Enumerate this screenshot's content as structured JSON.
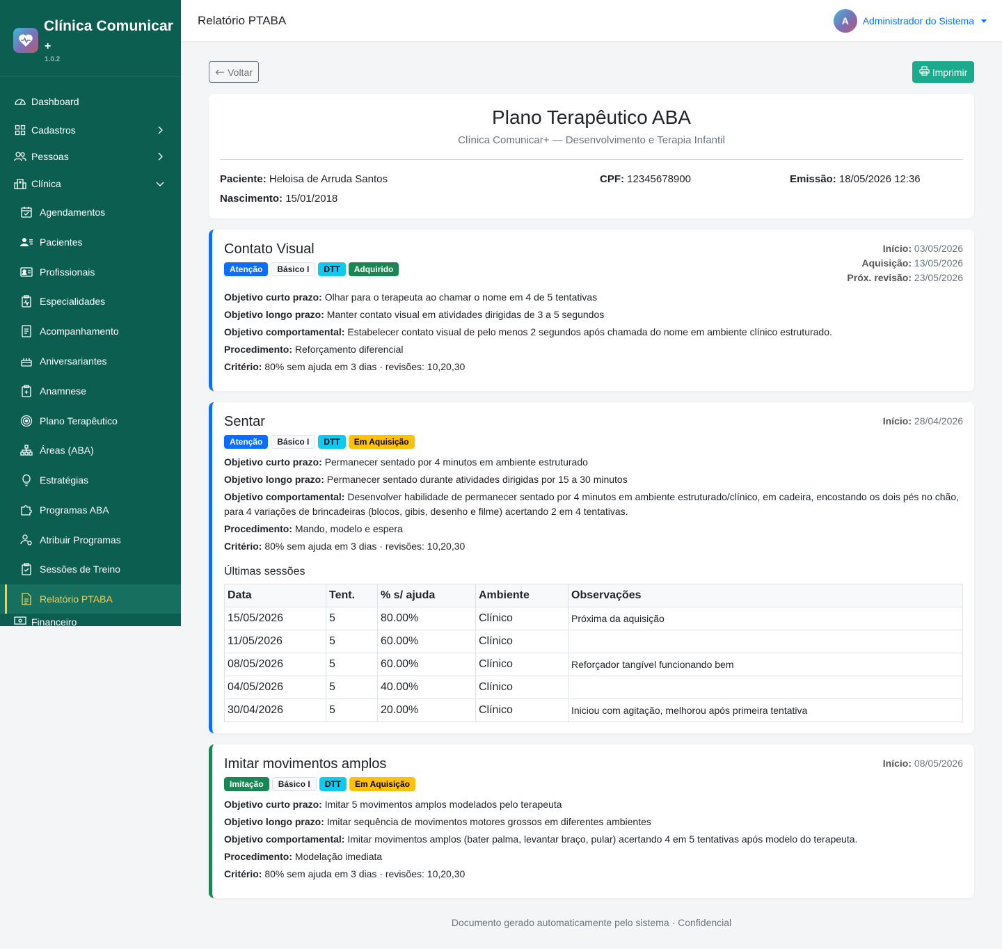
{
  "sidebar": {
    "brand_name": "Clínica Comunicar",
    "brand_plus": "+",
    "version": "1.0.2",
    "items": [
      {
        "label": "Dashboard"
      },
      {
        "label": "Cadastros"
      },
      {
        "label": "Pessoas"
      },
      {
        "label": "Clínica"
      },
      {
        "label": "Agendamentos"
      },
      {
        "label": "Pacientes"
      },
      {
        "label": "Profissionais"
      },
      {
        "label": "Especialidades"
      },
      {
        "label": "Acompanhamento"
      },
      {
        "label": "Aniversariantes"
      },
      {
        "label": "Anamnese"
      },
      {
        "label": "Plano Terapêutico"
      },
      {
        "label": "Áreas (ABA)"
      },
      {
        "label": "Estratégias"
      },
      {
        "label": "Programas ABA"
      },
      {
        "label": "Atribuir Programas"
      },
      {
        "label": "Sessões de Treino"
      },
      {
        "label": "Relatório PTABA"
      },
      {
        "label": "Financeiro"
      }
    ]
  },
  "header": {
    "title": "Relatório PTABA",
    "user_initial": "A",
    "user_name": "Administrador do Sistema"
  },
  "actions": {
    "back_label": "Voltar",
    "print_label": "Imprimir"
  },
  "document": {
    "title": "Plano Terapêutico ABA",
    "subtitle": "Clínica Comunicar+ — Desenvolvimento e Terapia Infantil",
    "patient_label": "Paciente:",
    "patient_value": "Heloisa de Arruda Santos",
    "cpf_label": "CPF:",
    "cpf_value": "12345678900",
    "emission_label": "Emissão:",
    "emission_value": "18/05/2026 12:36",
    "birth_label": "Nascimento:",
    "birth_value": "15/01/2018"
  },
  "labels": {
    "short": "Objetivo curto prazo:",
    "long": "Objetivo longo prazo:",
    "behavioral": "Objetivo comportamental:",
    "procedure": "Procedimento:",
    "criterion": "Critério:",
    "start": "Início:",
    "acquisition": "Aquisição:",
    "next_review": "Próx. revisão:"
  },
  "programs": [
    {
      "title": "Contato Visual",
      "badges": [
        "Atenção",
        "Básico I",
        "DTT",
        "Adquirido"
      ],
      "start": "03/05/2026",
      "acquisition": "13/05/2026",
      "next_review": "23/05/2026",
      "short": "Olhar para o terapeuta ao chamar o nome em 4 de 5 tentativas",
      "long": "Manter contato visual em atividades dirigidas de 3 a 5 segundos",
      "behavioral": "Estabelecer contato visual de pelo menos 2 segundos após chamada do nome em ambiente clínico estruturado.",
      "procedure": "Reforçamento diferencial",
      "criterion": "80% sem ajuda em 3 dias · revisões: 10,20,30"
    },
    {
      "title": "Sentar",
      "badges": [
        "Atenção",
        "Básico I",
        "DTT",
        "Em Aquisição"
      ],
      "start": "28/04/2026",
      "short": "Permanecer sentado por 4 minutos em ambiente estruturado",
      "long": "Permanecer sentado durante atividades dirigidas por 15 a 30 minutos",
      "behavioral": "Desenvolver habilidade de permanecer sentado por 4 minutos em ambiente estruturado/clínico, em cadeira, encostando os dois pés no chão, para 4 variações de brincadeiras (blocos, gibis, desenho e filme) acertando 2 em 4 tentativas.",
      "procedure": "Mando, modelo e espera",
      "criterion": "80% sem ajuda em 3 dias · revisões: 10,20,30",
      "sessions_title": "Últimas sessões",
      "sessions_headers": [
        "Data",
        "Tent.",
        "% s/ ajuda",
        "Ambiente",
        "Observações"
      ],
      "sessions": [
        [
          "15/05/2026",
          "5",
          "80.00%",
          "Clínico",
          "Próxima da aquisição"
        ],
        [
          "11/05/2026",
          "5",
          "60.00%",
          "Clínico",
          ""
        ],
        [
          "08/05/2026",
          "5",
          "60.00%",
          "Clínico",
          "Reforçador tangível funcionando bem"
        ],
        [
          "04/05/2026",
          "5",
          "40.00%",
          "Clínico",
          ""
        ],
        [
          "30/04/2026",
          "5",
          "20.00%",
          "Clínico",
          "Iniciou com agitação, melhorou após primeira tentativa"
        ]
      ]
    },
    {
      "title": "Imitar movimentos amplos",
      "badges": [
        "Imitação",
        "Básico I",
        "DTT",
        "Em Aquisição"
      ],
      "start": "08/05/2026",
      "short": "Imitar 5 movimentos amplos modelados pelo terapeuta",
      "long": "Imitar sequência de movimentos motores grossos em diferentes ambientes",
      "behavioral": "Imitar movimentos amplos (bater palma, levantar braço, pular) acertando 4 em 5 tentativas após modelo do terapeuta.",
      "procedure": "Modelação imediata",
      "criterion": "80% sem ajuda em 3 dias · revisões: 10,20,30"
    }
  ],
  "footer": "Documento gerado automaticamente pelo sistema · Confidencial",
  "colors": {
    "sidebar": "#0b5e50",
    "active": "#f5cf4c",
    "primary": "#0d6efd",
    "success": "#198754",
    "print": "#1aaa8c"
  }
}
